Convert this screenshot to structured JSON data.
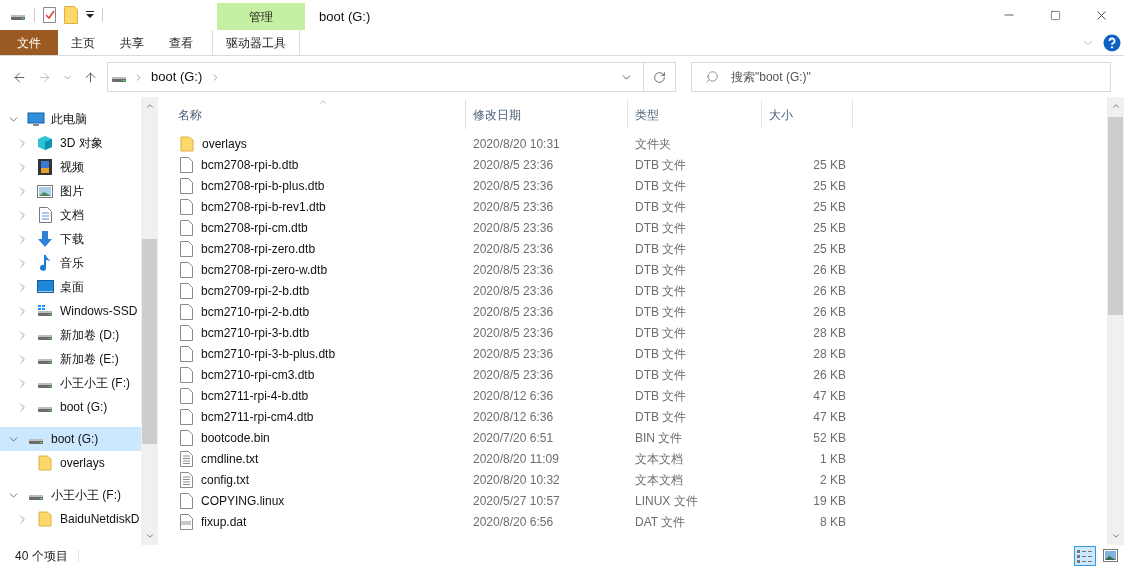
{
  "window": {
    "title": "boot (G:)"
  },
  "context_tab": {
    "label": "管理"
  },
  "ribbon_tabs": [
    {
      "label": "文件",
      "kind": "file"
    },
    {
      "label": "主页",
      "kind": "normal"
    },
    {
      "label": "共享",
      "kind": "normal"
    },
    {
      "label": "查看",
      "kind": "normal"
    },
    {
      "label": "驱动器工具",
      "kind": "contextual"
    }
  ],
  "address_bar": {
    "path": [
      "boot (G:)"
    ]
  },
  "search": {
    "placeholder": "搜索\"boot (G:)\""
  },
  "navigation_pane": {
    "groups": [
      {
        "label": "此电脑",
        "kind": "pc",
        "expanded": true,
        "selected": false,
        "children": [
          {
            "label": "3D 对象",
            "kind": "cube",
            "expanded": false,
            "selected": false
          },
          {
            "label": "视频",
            "kind": "video",
            "expanded": false,
            "selected": false
          },
          {
            "label": "图片",
            "kind": "pictures",
            "expanded": false,
            "selected": false
          },
          {
            "label": "文档",
            "kind": "documents",
            "expanded": false,
            "selected": false
          },
          {
            "label": "下载",
            "kind": "downloads",
            "expanded": false,
            "selected": false
          },
          {
            "label": "音乐",
            "kind": "music",
            "expanded": false,
            "selected": false
          },
          {
            "label": "桌面",
            "kind": "desktop",
            "expanded": false,
            "selected": false
          },
          {
            "label": "Windows-SSD",
            "kind": "system-drive",
            "expanded": false,
            "selected": false
          },
          {
            "label": "新加卷 (D:)",
            "kind": "drive",
            "expanded": false,
            "selected": false
          },
          {
            "label": "新加卷 (E:)",
            "kind": "drive",
            "expanded": false,
            "selected": false
          },
          {
            "label": "小王小王 (F:)",
            "kind": "drive",
            "expanded": false,
            "selected": false
          },
          {
            "label": "boot (G:)",
            "kind": "drive",
            "expanded": false,
            "selected": false
          }
        ]
      },
      {
        "label": "boot (G:)",
        "kind": "drive",
        "expanded": true,
        "selected": true,
        "children": [
          {
            "label": "overlays",
            "kind": "folder",
            "selected": false
          }
        ]
      },
      {
        "label": "小王小王 (F:)",
        "kind": "drive",
        "expanded": true,
        "selected": false,
        "children": [
          {
            "label": "BaiduNetdiskD",
            "kind": "folder",
            "expanded": false,
            "selected": false
          }
        ]
      }
    ]
  },
  "table": {
    "columns": [
      {
        "label": "名称",
        "sorted": true
      },
      {
        "label": "修改日期",
        "sorted": false
      },
      {
        "label": "类型",
        "sorted": false
      },
      {
        "label": "大小",
        "sorted": false
      }
    ],
    "rows": [
      {
        "name": "overlays",
        "modified": "2020/8/20 10:31",
        "type": "文件夹",
        "size": "",
        "kind": "folder"
      },
      {
        "name": "bcm2708-rpi-b.dtb",
        "modified": "2020/8/5 23:36",
        "type": "DTB 文件",
        "size": "25 KB",
        "kind": "file"
      },
      {
        "name": "bcm2708-rpi-b-plus.dtb",
        "modified": "2020/8/5 23:36",
        "type": "DTB 文件",
        "size": "25 KB",
        "kind": "file"
      },
      {
        "name": "bcm2708-rpi-b-rev1.dtb",
        "modified": "2020/8/5 23:36",
        "type": "DTB 文件",
        "size": "25 KB",
        "kind": "file"
      },
      {
        "name": "bcm2708-rpi-cm.dtb",
        "modified": "2020/8/5 23:36",
        "type": "DTB 文件",
        "size": "25 KB",
        "kind": "file"
      },
      {
        "name": "bcm2708-rpi-zero.dtb",
        "modified": "2020/8/5 23:36",
        "type": "DTB 文件",
        "size": "25 KB",
        "kind": "file"
      },
      {
        "name": "bcm2708-rpi-zero-w.dtb",
        "modified": "2020/8/5 23:36",
        "type": "DTB 文件",
        "size": "26 KB",
        "kind": "file"
      },
      {
        "name": "bcm2709-rpi-2-b.dtb",
        "modified": "2020/8/5 23:36",
        "type": "DTB 文件",
        "size": "26 KB",
        "kind": "file"
      },
      {
        "name": "bcm2710-rpi-2-b.dtb",
        "modified": "2020/8/5 23:36",
        "type": "DTB 文件",
        "size": "26 KB",
        "kind": "file"
      },
      {
        "name": "bcm2710-rpi-3-b.dtb",
        "modified": "2020/8/5 23:36",
        "type": "DTB 文件",
        "size": "28 KB",
        "kind": "file"
      },
      {
        "name": "bcm2710-rpi-3-b-plus.dtb",
        "modified": "2020/8/5 23:36",
        "type": "DTB 文件",
        "size": "28 KB",
        "kind": "file"
      },
      {
        "name": "bcm2710-rpi-cm3.dtb",
        "modified": "2020/8/5 23:36",
        "type": "DTB 文件",
        "size": "26 KB",
        "kind": "file"
      },
      {
        "name": "bcm2711-rpi-4-b.dtb",
        "modified": "2020/8/12 6:36",
        "type": "DTB 文件",
        "size": "47 KB",
        "kind": "file"
      },
      {
        "name": "bcm2711-rpi-cm4.dtb",
        "modified": "2020/8/12 6:36",
        "type": "DTB 文件",
        "size": "47 KB",
        "kind": "file"
      },
      {
        "name": "bootcode.bin",
        "modified": "2020/7/20 6:51",
        "type": "BIN 文件",
        "size": "52 KB",
        "kind": "file"
      },
      {
        "name": "cmdline.txt",
        "modified": "2020/8/20 11:09",
        "type": "文本文档",
        "size": "1 KB",
        "kind": "text"
      },
      {
        "name": "config.txt",
        "modified": "2020/8/20 10:32",
        "type": "文本文档",
        "size": "2 KB",
        "kind": "text"
      },
      {
        "name": "COPYING.linux",
        "modified": "2020/5/27 10:57",
        "type": "LINUX 文件",
        "size": "19 KB",
        "kind": "file"
      },
      {
        "name": "fixup.dat",
        "modified": "2020/8/20 6:56",
        "type": "DAT 文件",
        "size": "8 KB",
        "kind": "media"
      }
    ]
  },
  "status_bar": {
    "item_count": "40 个项目",
    "views": [
      {
        "kind": "details",
        "selected": true
      },
      {
        "kind": "thumbnails",
        "selected": false
      }
    ]
  }
}
